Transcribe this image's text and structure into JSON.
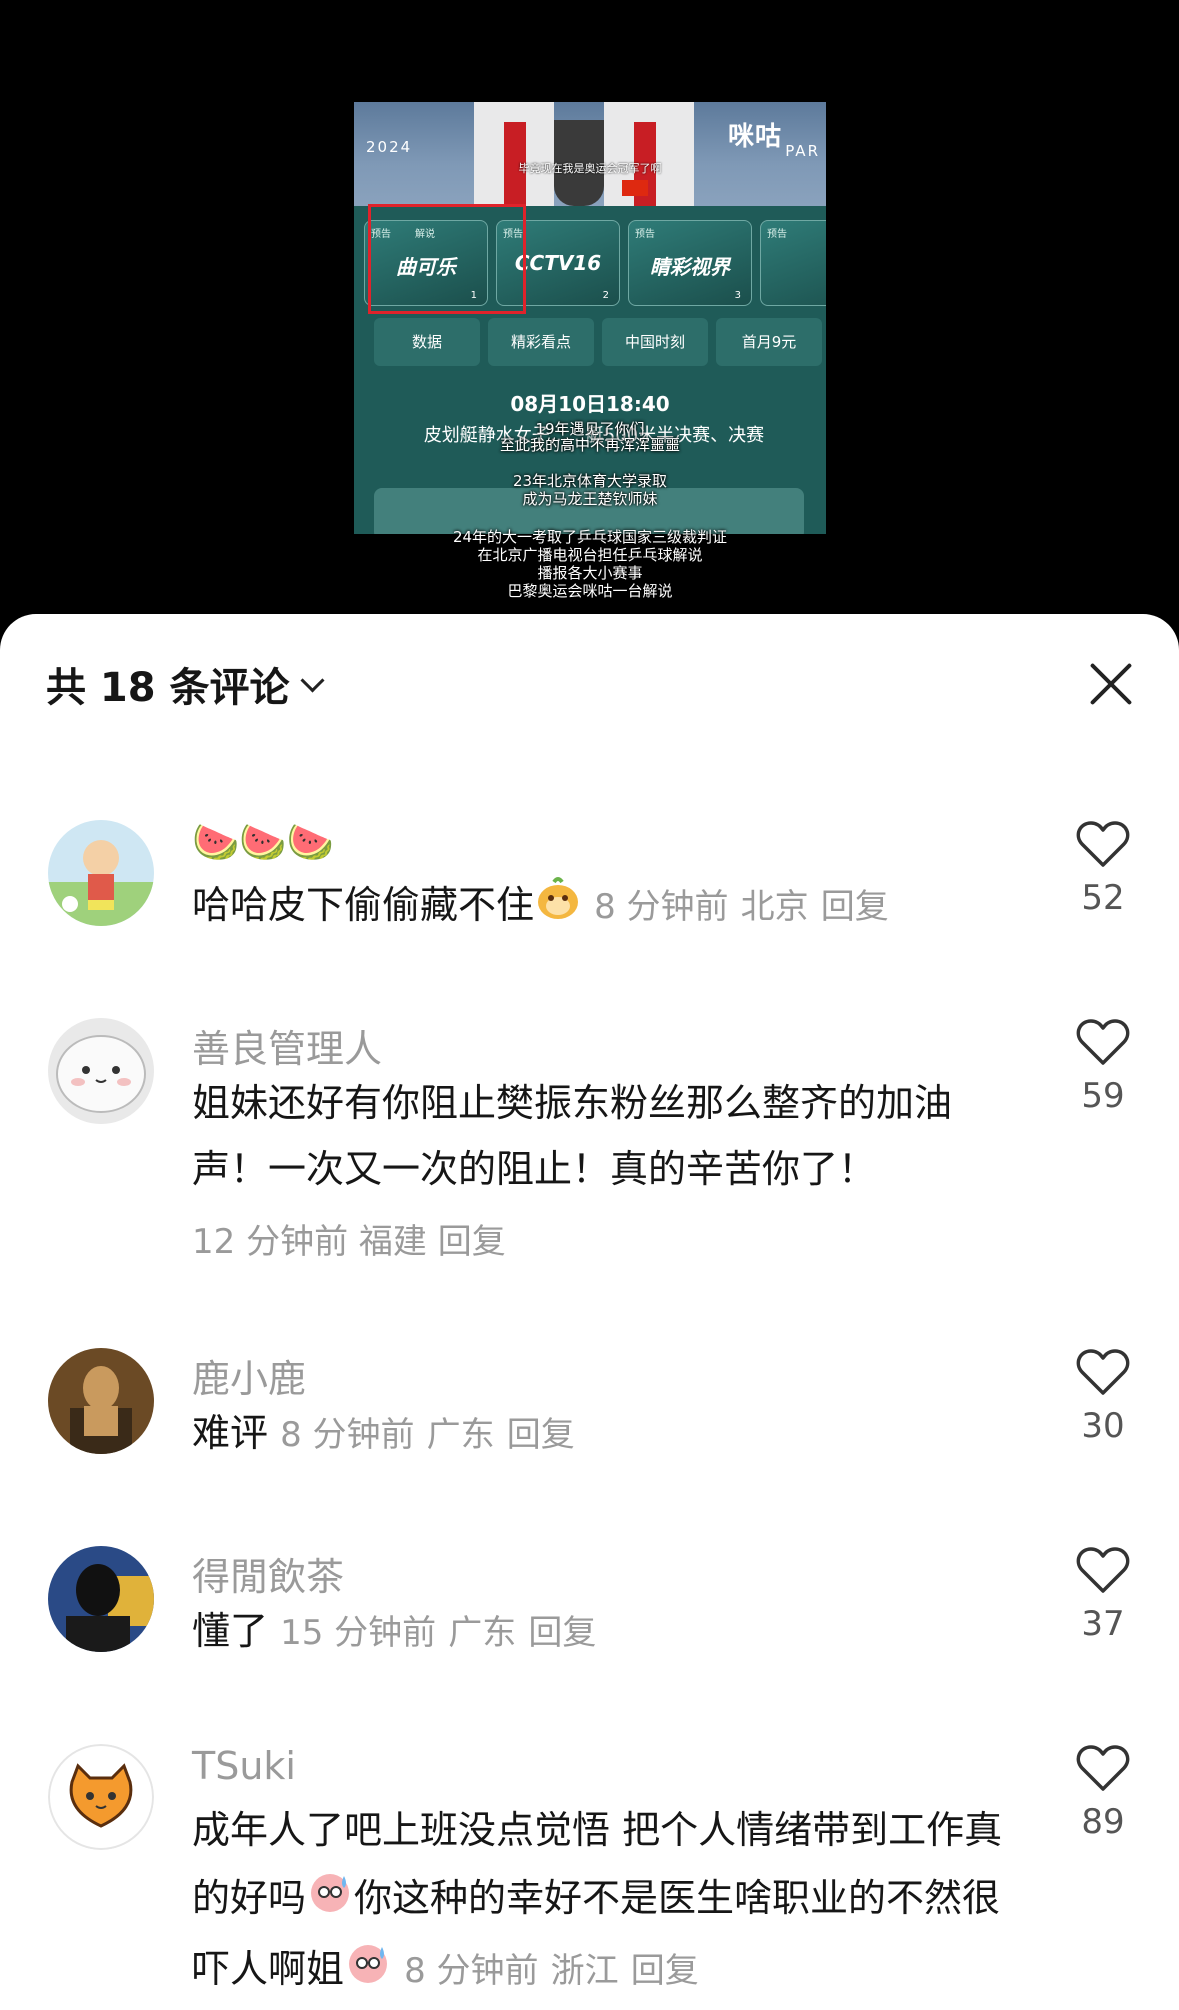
{
  "video": {
    "caption_top": "毕竟现在我是奥运会冠军了啊",
    "brand": "咪咕",
    "year": "2024",
    "city": "PAR",
    "channels": [
      {
        "tag": "预告",
        "tag2": "解说",
        "name": "曲可乐",
        "num": "1"
      },
      {
        "tag": "预告",
        "tag2": "",
        "name": "CCTV16",
        "num": "2"
      },
      {
        "tag": "预告",
        "tag2": "",
        "name": "睛彩视界",
        "num": "3"
      }
    ],
    "tabs": [
      "数据",
      "精彩看点",
      "中国时刻",
      "首月9元"
    ],
    "date": "08月10日18:40",
    "event_title": "皮划艇静水女子……艇500米半决赛、决赛",
    "subtitles_mid": [
      "19年遇见了你们",
      "至此我的高中不再浑浑噩噩",
      "23年北京体育大学录取",
      "成为马龙王楚钦师妹"
    ],
    "subtitles_bottom": [
      "24年的大一考取了乒乓球国家三级裁判证",
      "在北京广播电视台担任乒乓球解说",
      "播报各大小赛事",
      "巴黎奥运会咪咕一台解说"
    ]
  },
  "sheet": {
    "count_label": "共 18 条评论"
  },
  "comments": [
    {
      "name": "🍉🍉🍉",
      "body": "哈哈皮下偷偷藏不住",
      "time": "8 分钟前",
      "location": "北京",
      "reply": "回复",
      "likes": "52"
    },
    {
      "name": "善良管理人",
      "body": "姐妹还好有你阻止樊振东粉丝那么整齐的加油声！一次又一次的阻止！真的辛苦你了！",
      "time": "12 分钟前",
      "location": "福建",
      "reply": "回复",
      "likes": "59"
    },
    {
      "name": "鹿小鹿",
      "body": "难评",
      "time": "8 分钟前",
      "location": "广东",
      "reply": "回复",
      "likes": "30"
    },
    {
      "name": "得閒飲茶",
      "body": "懂了",
      "time": "15 分钟前",
      "location": "广东",
      "reply": "回复",
      "likes": "37"
    },
    {
      "name": "TSuki",
      "body": "成年人了吧上班没点觉悟 把个人情绪带到工作真的好吗",
      "body2": "你这种的幸好不是医生啥职业的不然很吓人啊姐",
      "time": "8 分钟前",
      "location": "浙江",
      "reply": "回复",
      "likes": "89"
    }
  ]
}
